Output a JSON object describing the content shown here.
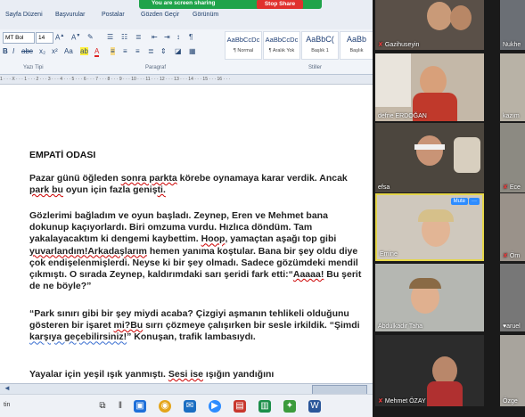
{
  "share_bar": {
    "status": "You are screen sharing",
    "stop_label": "Stop Share"
  },
  "menu": [
    "Sayfa Düzeni",
    "Başvurular",
    "Postalar",
    "Gözden Geçir",
    "Görünüm"
  ],
  "ribbon": {
    "font_name": "MT Bol",
    "font_size": "14",
    "styles": [
      {
        "sample": "AaBbCcDc",
        "name": "¶ Normal"
      },
      {
        "sample": "AaBbCcDc",
        "name": "¶ Aralık Yok"
      },
      {
        "sample": "AaBbC(",
        "name": "Başlık 1"
      },
      {
        "sample": "AaBb",
        "name": "Başlık"
      }
    ],
    "groups": {
      "font": "Yazı Tipi",
      "paragraph": "Paragraf",
      "styles": "Stiller"
    }
  },
  "ruler_text": "1 · · · X · · · 1 · · · 2 · · · 3 · · · 4 · · · 5 · · · 6 · · · 7 · · · 8 · · · 9 · · · 10 · · · 11 · · · 12 · · · 13 · · · 14 · · · 15 · · · 16 · · ·",
  "document": {
    "title": "EMPATİ ODASI",
    "p1": [
      {
        "t": "Pazar günü öğleden "
      },
      {
        "t": "sonra  parkta",
        "sq": 1
      },
      {
        "t": " körebe oynamaya karar verdik. Ancak "
      },
      {
        "t": "park  bu",
        "sq": 1
      },
      {
        "t": " oyun için fazla geniş"
      },
      {
        "t": "ti.",
        "sq": 1
      }
    ],
    "p2": [
      {
        "t": " Gözlerimi bağladım ve oyun başladı. Zeynep, Eren ve Mehmet bana dokunup kaçıyorlardı. Biri omzuma vurdu. Hızlıca döndüm. Tam yakalayacaktım ki dengemi kaybettim. "
      },
      {
        "t": "Hoop",
        "sq": 1
      },
      {
        "t": ", yamaçtan aşağı top gibi "
      },
      {
        "t": "yuvarlandım!Arkadaşlarım",
        "sq": 1
      },
      {
        "t": " hemen yanıma koştular. Bana bir şey oldu diye çok endişelenmişlerdi. Neyse ki bir şey olmadı. Sadece gözümdeki mendil çıkmıştı. O sırada Zeynep, kaldırımdaki sarı şeridi fark etti:“"
      },
      {
        "t": "Aaaaa!",
        "sq": 1
      },
      {
        "t": "  Bu şerit de ne böyle?”"
      }
    ],
    "p3": [
      {
        "t": "“Park sınırı gibi bir şey miydi acaba?  Çizgiyi aşmanın tehlikeli olduğunu gösteren bir işaret "
      },
      {
        "t": "mi?Bu",
        "sq": 1
      },
      {
        "t": " sırrı çözmeye çalışırken bir sesle irkildik. “Şimdi "
      },
      {
        "t": "karşıya geçebilirsiniz!",
        "sq2": 1
      },
      {
        "t": "” Konuşan, trafik lambasıydı."
      }
    ],
    "p4": [
      {
        "t": "Yayalar için yeşil ışık yanmıştı. "
      },
      {
        "t": "Sesi  ise",
        "sq": 1
      },
      {
        "t": " ışığın yandığını"
      }
    ]
  },
  "taskbar": {
    "left_text": "tin"
  },
  "gallery": {
    "participants": [
      {
        "name": "Gazihuseyin",
        "muted": true,
        "bg": "#5a5048"
      },
      {
        "name": "Nukhe",
        "muted": false,
        "bg": "#6b6f75"
      },
      {
        "name": "defne ERDOĞAN",
        "muted": false,
        "bg": "#c4b8a8"
      },
      {
        "name": "kazım",
        "muted": false,
        "bg": "#b8b2a6"
      },
      {
        "name": "efsa",
        "muted": false,
        "bg": "#4c463e"
      },
      {
        "name": "Ece",
        "muted": true,
        "bg": "#8c8a82"
      },
      {
        "name": "Emine",
        "muted": false,
        "bg": "#cfc8bd"
      },
      {
        "name": "Öm",
        "muted": true,
        "bg": "#9a928a"
      },
      {
        "name": "Abdulkadir  Taha",
        "muted": false,
        "bg": "#b5b7b2"
      },
      {
        "name": "♥aruel",
        "muted": false,
        "bg": "#777"
      },
      {
        "name": "Mehmet ÖZAY",
        "muted": true,
        "bg": "#2c2c2c"
      },
      {
        "name": "Özge",
        "muted": false,
        "bg": "#a8a49d"
      }
    ],
    "mute_label": "Mute",
    "more_label": "···"
  },
  "colors": {
    "share_green": "#1fa34a",
    "stop_red": "#e0302d",
    "zoom_blue": "#2d8cff",
    "active_speaker": "#e5d64a"
  }
}
